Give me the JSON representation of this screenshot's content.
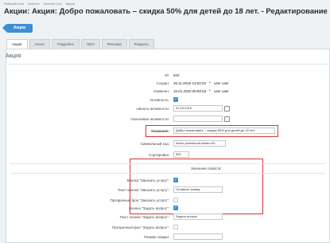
{
  "breadcrumbs": [
    "Рабочий стол",
    "Контент",
    "Контент (ст)",
    "Акции"
  ],
  "page_title": "Акции: Акция: Добро пожаловать – скидка 50% для детей до 18 лет. - Редактирование",
  "back_button": "Акции",
  "tabs": [
    "Акция",
    "Анонс",
    "Подробно",
    "SEO",
    "Реклама",
    "Разделы"
  ],
  "panel_title": "Акция",
  "fields": {
    "id_label": "ID:",
    "id_value": "615",
    "created_label": "Создан:",
    "created_value": "26.11.2019 13:52:02",
    "created_user": "user user",
    "changed_label": "Изменен:",
    "changed_value": "10.01.2020 00:50:53",
    "changed_user": "user user",
    "active_label": "Активность:",
    "start_label": "Начало активности:",
    "start_value": "01.03.2019",
    "end_label": "Окончание активности:",
    "end_value": "",
    "name_label": "Название:",
    "name_value": "Добро пожаловать – скидка 50% для детей до 18 лет.",
    "code_label": "Символьный код:",
    "code_value": "dobro-pozhalovat-skidka-50-",
    "sort_label": "Сортировка:",
    "sort_value": "500"
  },
  "props": {
    "heading": "Значения свойств:",
    "btn_order_label": "Кнопка \"Заказать услугу\":",
    "btn_order_text_label": "Текст кнопки \"Заказать услугу\":",
    "btn_order_text_value": "Оставить заявку",
    "transparent_bg1_label": "Прозрачный фон \"Заказать услугу\":",
    "btn_ask_label": "Кнопка \"Задать вопрос\":",
    "btn_ask_text_label": "Текст кнопки \"Задать вопрос\":",
    "btn_ask_text_value": "Задать вопрос",
    "transparent_bg2_label": "Прозрачный фон \"Задать вопрос\":",
    "discount_label": "Размер скидки:"
  },
  "accent_color": "#3a8fd6",
  "highlight_color": "#dd3333"
}
